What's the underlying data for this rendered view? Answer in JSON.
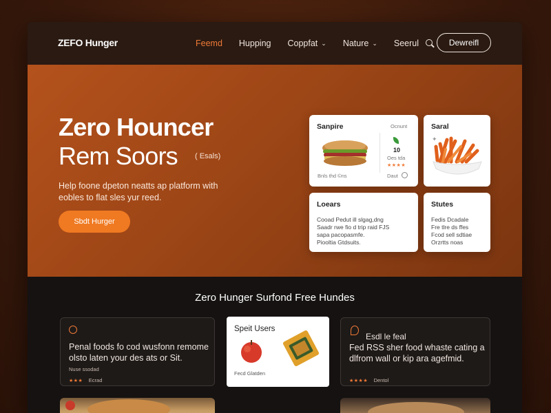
{
  "header": {
    "logo": "ZEFO Hunger",
    "nav": [
      {
        "label": "Feemd",
        "active": true,
        "dropdown": false
      },
      {
        "label": "Hupping",
        "active": false,
        "dropdown": false
      },
      {
        "label": "Coppfat",
        "active": false,
        "dropdown": true
      },
      {
        "label": "Nature",
        "active": false,
        "dropdown": true
      },
      {
        "label": "Seerul",
        "active": false,
        "dropdown": false
      }
    ],
    "cta": "Dewreifl"
  },
  "hero": {
    "title_line1": "Zero Houncer",
    "title_line2": "Rem Soors",
    "tag": "( Esals)",
    "description": "Help foone dpeton neatts ap platform with eobles to flat sles yur reed.",
    "button": "Sbdt Hurger"
  },
  "cards": {
    "sandwich": {
      "title": "Sanpire",
      "meta": "Ocnunt",
      "count": "10",
      "count_label": "Oes tda",
      "footer": "Bnls thd ©ns",
      "footer_right": "Daut"
    },
    "fries": {
      "title": "Saral"
    },
    "losers": {
      "title": "Loears",
      "lines": [
        "Cooad Pedut ill slgag,dng",
        "Saadr rwe fio d trip raid FJS",
        "sapa pacopasmfe.",
        "Piooltia Gtdsuits."
      ]
    },
    "stules": {
      "title": "Stutes",
      "lines": [
        "Fedis Dcadale",
        "Fre tlre ds ffes",
        "Fcod sell sdtiae",
        "Orzrtts noas"
      ]
    }
  },
  "section2": {
    "title": "Zero Hunger Surfond Free Hundes",
    "left_card": {
      "text": "Penal foods fo cod wusfonn remome olsto laten your des ats or Sit.",
      "footer": "Nuse ssodad",
      "footer_right": "Ecrad"
    },
    "mid_card": {
      "title": "Speit Users",
      "footer": "Fecd Glatden"
    },
    "right_card": {
      "title": "Esdl le feal",
      "text": "Fed RSS sher food whaste cating a dlfrom wall or kip ara agefmid.",
      "footer_right": "Dentol"
    }
  },
  "colors": {
    "accent": "#f07a36",
    "hero_bg": "#a84c18",
    "dark_bg": "#151211",
    "header_bg": "#2a1a12"
  }
}
